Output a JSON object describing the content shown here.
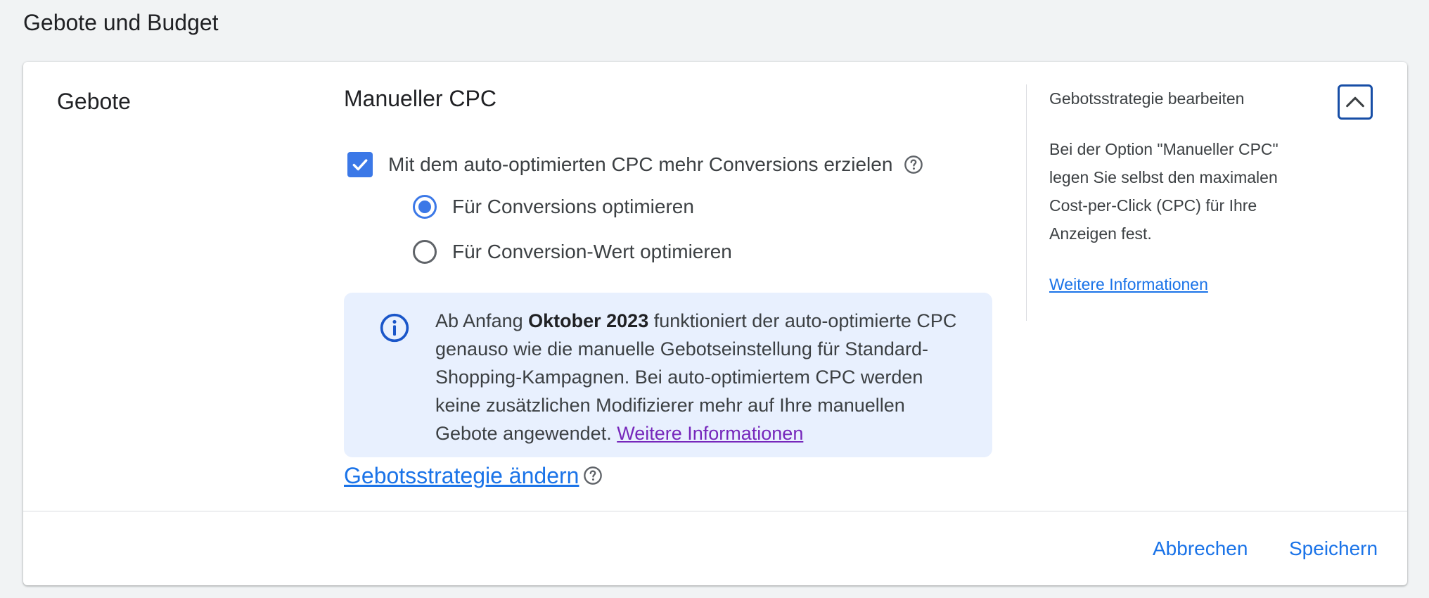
{
  "page": {
    "title": "Gebote und Budget"
  },
  "section": {
    "title": "Gebote"
  },
  "strategy": {
    "name": "Manueller CPC",
    "enhanced_cpc": {
      "label": "Mit dem auto-optimierten CPC mehr Conversions erzielen",
      "checked": true,
      "options": [
        {
          "label": "Für Conversions optimieren",
          "selected": true
        },
        {
          "label": "Für Conversion-Wert optimieren",
          "selected": false
        }
      ]
    },
    "info": {
      "prefix": "Ab Anfang ",
      "bold": "Oktober 2023",
      "body": " funktioniert der auto-optimierte CPC genauso wie die manuelle Gebotseinstellung für Standard-Shopping-Kampagnen. Bei auto-optimiertem CPC werden keine zusätzlichen Modifizierer mehr auf Ihre manuellen Gebote angewendet. ",
      "link": "Weitere Informationen"
    },
    "change_link": "Gebotsstrategie ändern "
  },
  "side_panel": {
    "title": "Gebotsstrategie bearbeiten",
    "description": "Bei der Option \"Manueller CPC\" legen Sie selbst den maximalen Cost-per-Click (CPC) für Ihre Anzeigen fest.",
    "link": "Weitere Informationen"
  },
  "footer": {
    "cancel": "Abbrechen",
    "save": "Speichern"
  },
  "colors": {
    "accent": "#3b78e7",
    "link": "#1a73e8",
    "visited_link": "#7627bb",
    "info_bg": "#e8f0fe",
    "page_bg": "#f1f3f4"
  },
  "icons": [
    "check-icon",
    "help-icon",
    "info-icon",
    "chevron-up-icon"
  ]
}
